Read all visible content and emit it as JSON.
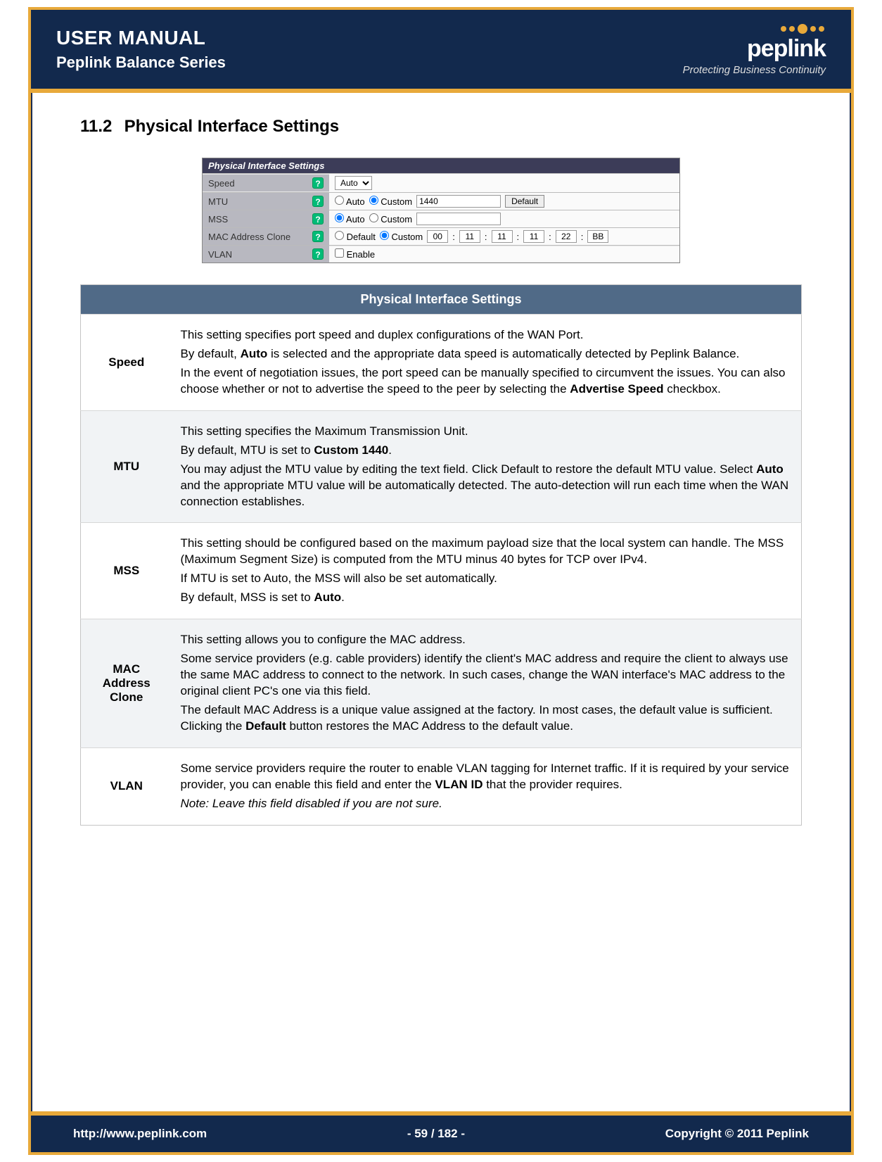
{
  "header": {
    "title": "USER MANUAL",
    "subtitle": "Peplink Balance Series",
    "logo_text": "peplink",
    "logo_tagline": "Protecting Business Continuity"
  },
  "section": {
    "number": "11.2",
    "title": "Physical Interface Settings"
  },
  "ui_panel": {
    "title": "Physical Interface Settings",
    "rows": {
      "speed": {
        "label": "Speed",
        "select_value": "Auto"
      },
      "mtu": {
        "label": "MTU",
        "radio_auto": "Auto",
        "radio_custom": "Custom",
        "value": "1440",
        "btn": "Default"
      },
      "mss": {
        "label": "MSS",
        "radio_auto": "Auto",
        "radio_custom": "Custom",
        "value": ""
      },
      "mac": {
        "label": "MAC Address Clone",
        "radio_default": "Default",
        "radio_custom": "Custom",
        "octets": [
          "00",
          "11",
          "11",
          "11",
          "22",
          "BB"
        ]
      },
      "vlan": {
        "label": "VLAN",
        "checkbox_label": "Enable"
      }
    }
  },
  "table": {
    "header": "Physical Interface Settings",
    "rows": [
      {
        "label": "Speed",
        "paras": [
          "This setting specifies port speed and duplex configurations of the WAN Port.",
          "By default, <strong>Auto</strong> is selected and the appropriate data speed is automatically detected by Peplink Balance.",
          "In the event of negotiation issues, the port speed can be manually specified to circumvent the issues.  You can also choose whether or not to advertise the speed to the peer by selecting the <strong>Advertise Speed</strong> checkbox."
        ]
      },
      {
        "label": "MTU",
        "paras": [
          "This setting specifies the Maximum Transmission Unit.",
          "By default, MTU is set to <strong>Custom 1440</strong>.",
          "You may adjust the MTU value by editing the text field. Click Default to restore the default MTU value.  Select <strong>Auto</strong> and the appropriate MTU value will be automatically detected. The auto-detection will run each time when the WAN connection establishes."
        ]
      },
      {
        "label": "MSS",
        "paras": [
          "This setting should be configured based on the maximum payload size that the local system can handle.  The MSS (Maximum Segment Size) is computed from the MTU minus 40 bytes for TCP over IPv4.",
          "If MTU is set to Auto, the MSS will also be set automatically.",
          "By default, MSS is set to <strong>Auto</strong>."
        ]
      },
      {
        "label": "MAC Address Clone",
        "paras": [
          "This setting allows you to configure the MAC address.",
          "Some service providers (e.g. cable providers) identify the client's MAC address and require the client to always use the same MAC address to connect to the network.  In such cases, change the WAN interface's MAC address to the original client PC's one via this field.",
          "The default MAC Address is a unique value assigned at the factory.  In most cases, the default value is sufficient. Clicking the <strong>Default</strong> button restores the MAC Address to the default value."
        ]
      },
      {
        "label": "VLAN",
        "paras": [
          "Some service providers require the router to enable VLAN tagging for Internet traffic.  If it is required by your service provider, you can enable this field and enter the <strong>VLAN ID</strong> that the provider requires.",
          "<span class=\"italic\">Note: Leave this field disabled if you are not sure.</span>"
        ]
      }
    ]
  },
  "footer": {
    "url": "http://www.peplink.com",
    "page": "- 59 / 182 -",
    "copyright": "Copyright © 2011 Peplink"
  }
}
